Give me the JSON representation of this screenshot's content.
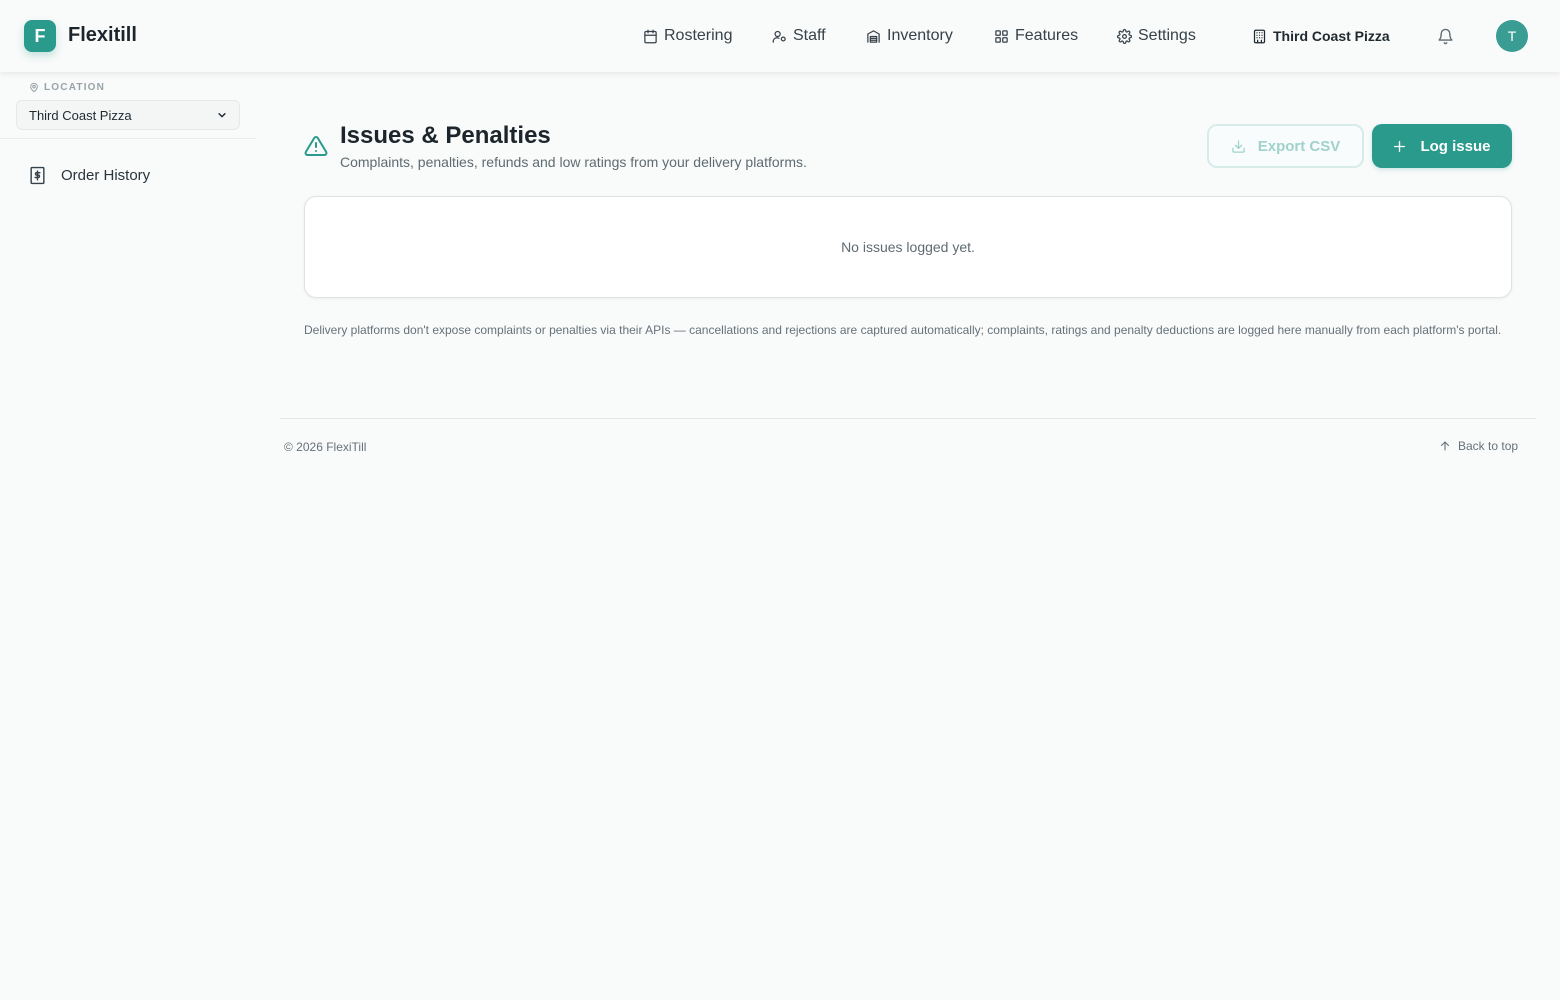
{
  "app": {
    "brand_initial": "F",
    "brand_name": "Flexitill",
    "accent_color": "#2a9a8d"
  },
  "nav": {
    "items": [
      {
        "label": "Rostering",
        "icon": "calendar-icon"
      },
      {
        "label": "Staff",
        "icon": "user-cog-icon"
      },
      {
        "label": "Inventory",
        "icon": "warehouse-icon"
      },
      {
        "label": "Features",
        "icon": "grid-icon"
      },
      {
        "label": "Settings",
        "icon": "gear-icon"
      }
    ],
    "location": {
      "label": "Third Coast Pizza",
      "icon": "building-icon"
    },
    "notifications_icon": "bell-icon",
    "avatar_initial": "T"
  },
  "sidebar": {
    "location_label": "LOCATION",
    "location_selected": "Third Coast Pizza",
    "items": [
      {
        "label": "Order History",
        "icon": "receipt-dollar-icon"
      }
    ]
  },
  "main": {
    "title": "Issues & Penalties",
    "subtitle": "Complaints, penalties, refunds and low ratings from your delivery platforms.",
    "export_label": "Export CSV",
    "log_label": "Log issue",
    "empty_text": "No issues logged yet.",
    "note": "Delivery platforms don't expose complaints or penalties via their APIs — cancellations and rejections are captured automatically; complaints, ratings and penalty deductions are logged here manually from each platform's portal."
  },
  "footer": {
    "copyright": "© 2026 FlexiTill",
    "back_to_top": "Back to top"
  }
}
